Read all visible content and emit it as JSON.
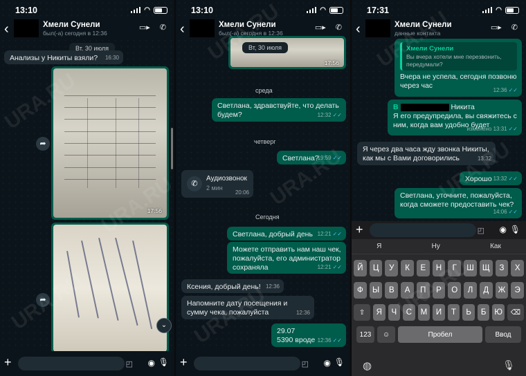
{
  "panel1": {
    "status_time": "13:10",
    "contact_name": "Хмели Сунели",
    "contact_sub": "был(-а) сегодня в 12:36",
    "day_pill": "Вт, 30 июля",
    "messages": [
      {
        "text": "Анализы у Никиты взяли?",
        "time": "16:30"
      }
    ],
    "photo1_time": "17:56"
  },
  "panel2": {
    "status_time": "13:10",
    "contact_name": "Хмели Сунели",
    "contact_sub": "был(-а) сегодня в 12:36",
    "day_pill": "Вт, 30 июля",
    "photo_time": "17:56",
    "day_wed": "среда",
    "msg_wed": {
      "text": "Светлана, здравствуйте, что делать будем?",
      "time": "12:32"
    },
    "day_thu": "четверг",
    "msg_thu": {
      "text": "Светлана?",
      "time": "19:59"
    },
    "call": {
      "title": "Аудиозвонок",
      "sub": "2 мин",
      "time": "20:06"
    },
    "day_today": "Сегодня",
    "msgs_today": [
      {
        "text": "Светлана, добрый день",
        "time": "12:21"
      },
      {
        "text": "Можете отправить нам наш чек, пожалуйста, его администратор сохраняла",
        "time": "12:21"
      },
      {
        "text": "Ксения, добрый день!",
        "time": "12:36"
      },
      {
        "text": "Напомните дату посещения и сумму чека, пожалуйста",
        "time": "12:36"
      },
      {
        "text_line1": "29.07",
        "text_line2": "5390 вроде",
        "time": "12:36"
      }
    ]
  },
  "panel3": {
    "status_time": "17:31",
    "contact_name": "Хмели Сунели",
    "contact_sub": "данные контакта",
    "reply_quote": {
      "name": "Хмели Сунели",
      "text": "Вы вчера хотели мне перезвонить, передумали?"
    },
    "reply_text": "Вчера не успела, сегодня позвоню через час",
    "reply_time": "12:36",
    "msg_nikita": {
      "prefix": "В",
      "name": "Никита",
      "text": "Я его предупредила, вы свяжитесь с ним, когда вам удобно будет",
      "time": "изменено 13:31"
    },
    "msg_in": {
      "text": "Я через два часа жду звонка Никиты, как мы с Вами договорились",
      "time": "13:32"
    },
    "msg_ok": {
      "text": "Хорошо",
      "time": "13:32"
    },
    "msg_check": {
      "text": "Светлана, уточните, пожалуйста, когда сможете предоставить чек?",
      "time": "14:06"
    },
    "suggestions": [
      "Я",
      "Ну",
      "Как"
    ],
    "row1": [
      "Й",
      "Ц",
      "У",
      "К",
      "Е",
      "Н",
      "Г",
      "Ш",
      "Щ",
      "З",
      "Х"
    ],
    "row2": [
      "Ф",
      "Ы",
      "В",
      "А",
      "П",
      "Р",
      "О",
      "Л",
      "Д",
      "Ж",
      "Э"
    ],
    "row3": [
      "Я",
      "Ч",
      "С",
      "М",
      "И",
      "Т",
      "Ь",
      "Б",
      "Ю"
    ],
    "num_key": "123",
    "space_key": "Пробел",
    "return_key": "Ввод"
  },
  "watermark": "URA.RU",
  "icons": {
    "back": "chevron-left-icon",
    "video": "video-icon",
    "phone": "phone-icon"
  }
}
